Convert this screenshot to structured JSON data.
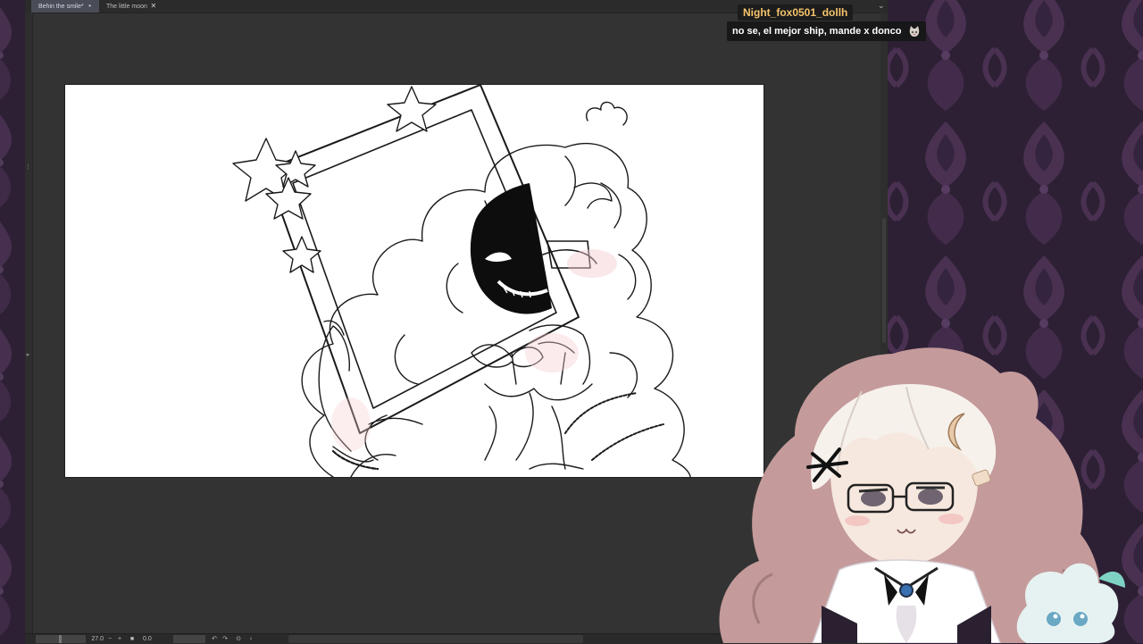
{
  "app": {
    "tabs": [
      {
        "label": "Behin the smile*",
        "active": true,
        "close_icon": "dot-icon"
      },
      {
        "label": "The little moon",
        "active": false,
        "close_icon": "close-icon"
      }
    ],
    "window_control": "chevron-down-icon"
  },
  "canvas": {
    "background": "#ffffff",
    "artwork": "line-art-girl-with-mask-frame"
  },
  "statusbar": {
    "zoom": "27.0",
    "zoom_minus": "−",
    "zoom_plus": "+",
    "angle": "0.0"
  },
  "chat": {
    "username": "Night_fox0501_dollh",
    "message": "no se, el mejor ship, mande x donco",
    "username_color": "#f5c36b",
    "emote": "cat-emote"
  },
  "colors": {
    "wallpaper_base": "#2d2034",
    "wallpaper_pattern": "#4a3050",
    "app_bg": "#333333",
    "avatar_hair": "#c99a9a"
  }
}
